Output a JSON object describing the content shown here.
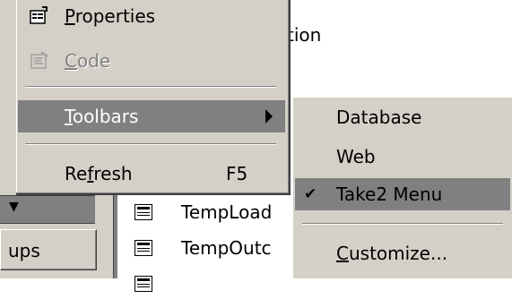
{
  "background": {
    "groups_button": "ups",
    "partial_text": "tion",
    "list_items": [
      "TempLoad",
      "TempOutc"
    ]
  },
  "context_menu": {
    "items": [
      {
        "label_pre": "",
        "mnemonic": "P",
        "label_post": "roperties",
        "icon": "properties-icon",
        "enabled": true
      },
      {
        "label_pre": "",
        "mnemonic": "C",
        "label_post": "ode",
        "icon": "code-icon",
        "enabled": false
      },
      {
        "label_pre": "",
        "mnemonic": "T",
        "label_post": "oolbars",
        "enabled": true,
        "active": true,
        "submenu": true
      },
      {
        "label_pre": "Re",
        "mnemonic": "f",
        "label_post": "resh",
        "shortcut": "F5",
        "enabled": true
      }
    ]
  },
  "toolbars_submenu": {
    "items": [
      {
        "label": "Database",
        "checked": false
      },
      {
        "label": "Web",
        "checked": false
      },
      {
        "label": "Take2 Menu",
        "checked": true
      },
      {
        "label_pre": "",
        "mnemonic": "C",
        "label_post": "ustomize...",
        "checked": false
      }
    ],
    "check_glyph": "✔"
  },
  "colors": {
    "menu_face": "#d4d0c8",
    "highlight": "#808080",
    "disabled_text": "#808080"
  }
}
